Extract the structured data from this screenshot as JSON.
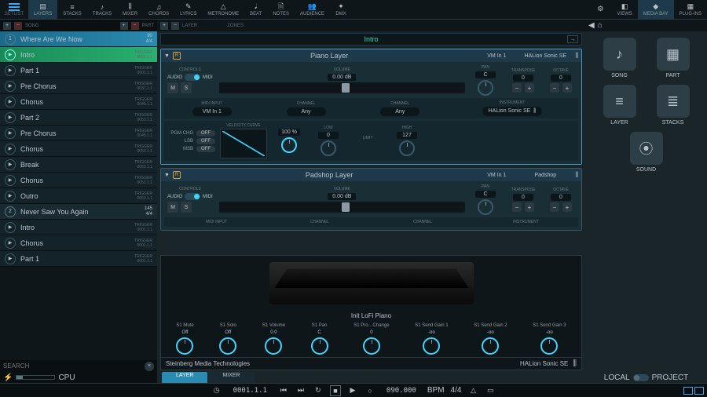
{
  "menu": {
    "label": "SETLIST"
  },
  "topTabs": [
    {
      "id": "layers",
      "label": "LAYERS",
      "icon": "▤",
      "active": true
    },
    {
      "id": "stacks",
      "label": "STACKS",
      "icon": "≡"
    },
    {
      "id": "tracks",
      "label": "TRACKS",
      "icon": "♪"
    },
    {
      "id": "mixer",
      "label": "MIXER",
      "icon": "⫼"
    },
    {
      "id": "chords",
      "label": "CHORDS",
      "icon": "♫"
    },
    {
      "id": "lyrics",
      "label": "LYRICS",
      "icon": "✎"
    },
    {
      "id": "metronome",
      "label": "METRONOME",
      "icon": "△"
    },
    {
      "id": "beat",
      "label": "BEAT",
      "icon": "𝅘𝅥"
    },
    {
      "id": "notes",
      "label": "NOTES",
      "icon": "🗎"
    },
    {
      "id": "audience",
      "label": "AUDIENCE",
      "icon": "👥"
    },
    {
      "id": "dmx",
      "label": "DMX",
      "icon": "✦"
    }
  ],
  "topRight": [
    {
      "id": "settings",
      "label": "",
      "icon": "⚙"
    },
    {
      "id": "views",
      "label": "VIEWS",
      "icon": "◧"
    },
    {
      "id": "mediabay",
      "label": "MEDIA BAY",
      "icon": "◆",
      "active": true
    },
    {
      "id": "plugins",
      "label": "PLUG-INS",
      "icon": "▦"
    }
  ],
  "lpHead": {
    "songLbl": "SONG",
    "partLbl": "PART"
  },
  "setlist": [
    {
      "type": "song",
      "num": "1",
      "name": "Where Are We Now",
      "tempo": "90",
      "sig": "4/4",
      "active": true
    },
    {
      "type": "part",
      "name": "Intro",
      "trig": "TRIGGER",
      "bar": "0001.1.1",
      "playing": true
    },
    {
      "type": "part",
      "name": "Part 1",
      "trig": "TRIGGER",
      "bar": "0001.1.1"
    },
    {
      "type": "part",
      "name": "Pre Chorus",
      "trig": "TRIGGER",
      "bar": "0037.1.1"
    },
    {
      "type": "part",
      "name": "Chorus",
      "trig": "TRIGGER",
      "bar": "0045.1.1"
    },
    {
      "type": "part",
      "name": "Part 2",
      "trig": "TRIGGER",
      "bar": "0053.1.1"
    },
    {
      "type": "part",
      "name": "Pre Chorus",
      "trig": "TRIGGER",
      "bar": "0045.1.1"
    },
    {
      "type": "part",
      "name": "Chorus",
      "trig": "TRIGGER",
      "bar": "0053.1.1"
    },
    {
      "type": "part",
      "name": "Break",
      "trig": "TRIGGER",
      "bar": "0053.1.1"
    },
    {
      "type": "part",
      "name": "Chorus",
      "trig": "TRIGGER",
      "bar": "0053.1.1"
    },
    {
      "type": "part",
      "name": "Outro",
      "trig": "TRIGGER",
      "bar": "0053.1.1"
    },
    {
      "type": "song",
      "num": "2",
      "name": "Never Saw You Again",
      "tempo": "145",
      "sig": "4/4"
    },
    {
      "type": "part",
      "name": "Intro",
      "trig": "TRIGGER",
      "bar": "0001.1.1"
    },
    {
      "type": "part",
      "name": "Chorus",
      "trig": "TRIGGER",
      "bar": "0001.1.1"
    },
    {
      "type": "part",
      "name": "Part 1",
      "trig": "TRIGGER",
      "bar": "0001.1.1"
    }
  ],
  "search": {
    "placeholder": "SEARCH",
    "cpuLbl": "CPU"
  },
  "cTop": {
    "layerLbl": "LAYER",
    "zonesLbl": "ZONES"
  },
  "partBar": {
    "name": "Intro"
  },
  "layers": [
    {
      "name": "Piano Layer",
      "vm": "VM In 1",
      "inst": "HALion Sonic SE",
      "selected": true,
      "controls": "CONTROLS",
      "audio": "AUDIO",
      "midi": "MIDI",
      "m": "M",
      "s": "S",
      "volumeLbl": "VOLUME",
      "volume": "0.00 dB",
      "panLbl": "PAN",
      "pan": "C",
      "transLbl": "TRANSPOSE",
      "trans": "0",
      "octLbl": "OCTAVE",
      "oct": "0",
      "midiInLbl": "MIDI INPUT",
      "midiIn": "VM In 1",
      "chanLbl": "CHANNEL",
      "chan1": "Any",
      "chan2": "Any",
      "instLbl": "INSTRUMENT",
      "instName": "HALion Sonic SE",
      "pgmChg": "PGM CHG",
      "lsb": "LSB",
      "msb": "MSB",
      "off": "OFF",
      "velLbl": "VELOCITY CURVE",
      "vel": "100 %",
      "lowLbl": "LOW",
      "low": "0",
      "limitLbl": "LIMIT",
      "highLbl": "HIGH",
      "high": "127"
    },
    {
      "name": "Padshop Layer",
      "vm": "VM In 1",
      "inst": "Padshop",
      "controls": "CONTROLS",
      "audio": "AUDIO",
      "midi": "MIDI",
      "m": "M",
      "s": "S",
      "volumeLbl": "VOLUME",
      "volume": "0.00 dB",
      "panLbl": "PAN",
      "pan": "C",
      "transLbl": "TRANSPOSE",
      "trans": "0",
      "octLbl": "OCTAVE",
      "oct": "0",
      "midiInLbl": "MIDI INPUT",
      "chanLbl": "CHANNEL",
      "instLbl": "INSTRUMENT"
    }
  ],
  "instrument": {
    "preset": "Init LoFi Piano",
    "manufacturer": "Steinberg Media Technologies",
    "name": "HALion Sonic SE",
    "params": [
      {
        "lbl": "S1 Mute",
        "val": "Off"
      },
      {
        "lbl": "S1 Solo",
        "val": "Off"
      },
      {
        "lbl": "S1 Volume",
        "val": "0.0"
      },
      {
        "lbl": "S1 Pan",
        "val": "C"
      },
      {
        "lbl": "S1 Pro…Change",
        "val": "0"
      },
      {
        "lbl": "S1 Send Gain 1",
        "val": "-oo"
      },
      {
        "lbl": "S1 Send Gain 2",
        "val": "-oo"
      },
      {
        "lbl": "S1 Send Gain 3",
        "val": "-oo"
      }
    ]
  },
  "tabs": {
    "layer": "LAYER",
    "mixer": "MIXER"
  },
  "transport": {
    "pos": "0001.1.1",
    "tempo": "090.000",
    "bpm": "BPM",
    "sig": "4/4"
  },
  "mediabay": {
    "tiles": [
      {
        "id": "song",
        "label": "SONG",
        "icon": "♪"
      },
      {
        "id": "part",
        "label": "PART",
        "icon": "▦"
      },
      {
        "id": "layer",
        "label": "LAYER",
        "icon": "≡"
      },
      {
        "id": "stacks",
        "label": "STACKS",
        "icon": "≣"
      },
      {
        "id": "sound",
        "label": "SOUND",
        "icon": "⦿"
      }
    ],
    "local": "LOCAL",
    "project": "PROJECT"
  }
}
